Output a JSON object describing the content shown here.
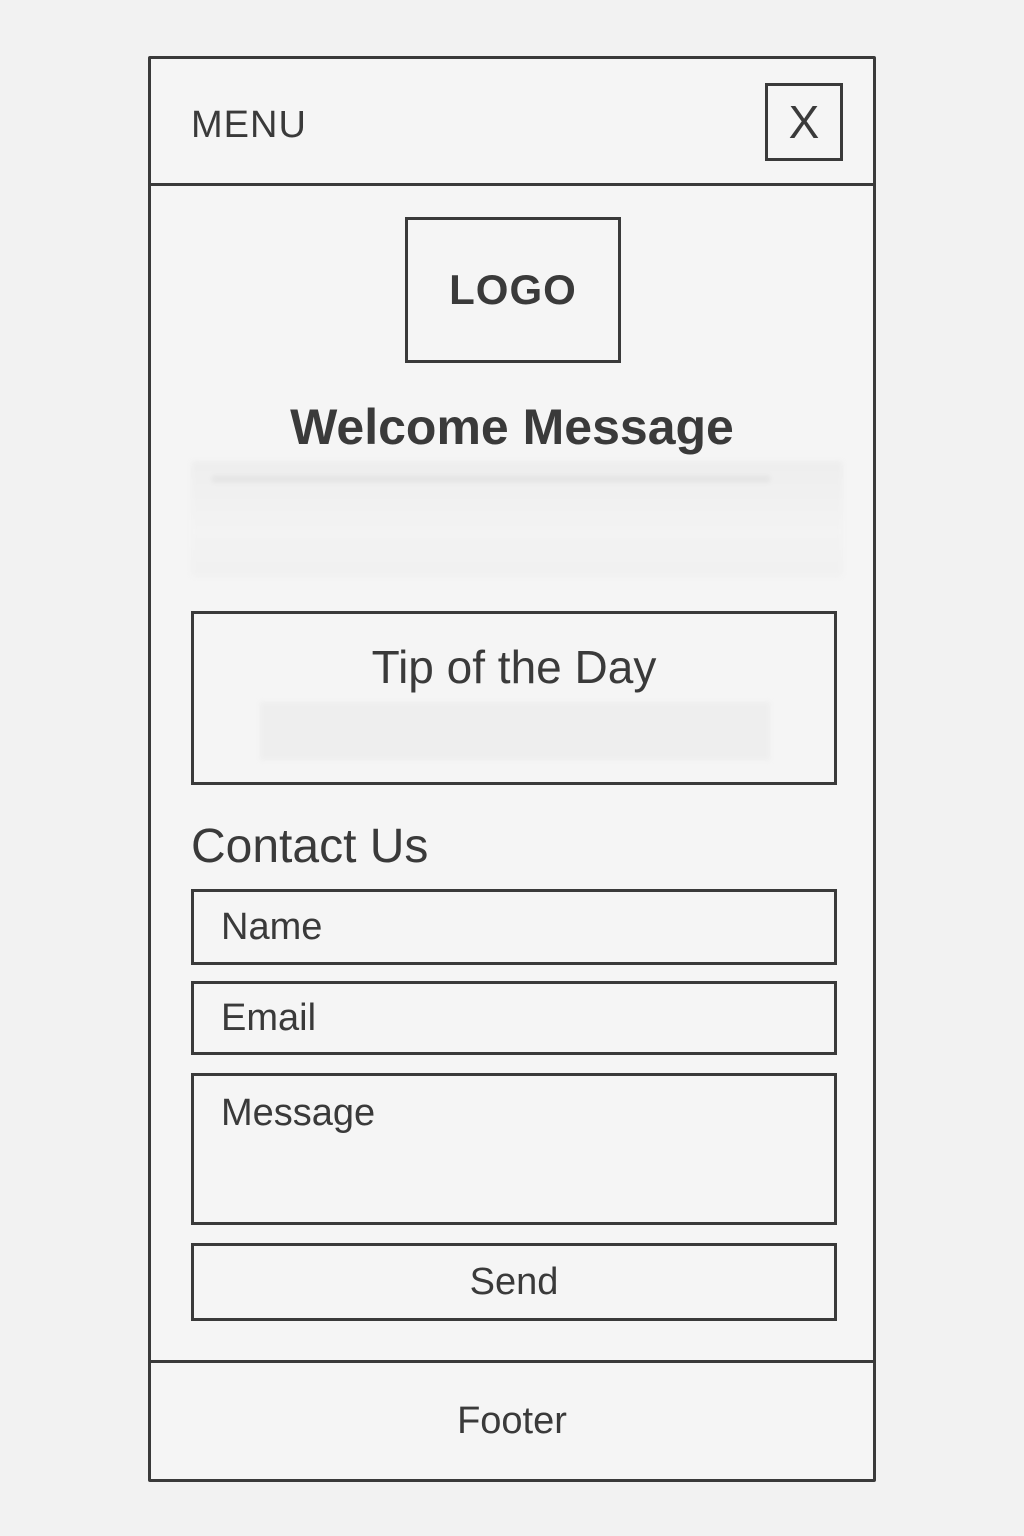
{
  "header": {
    "menu_label": "MENU",
    "close_label": "X"
  },
  "logo": {
    "label": "LOGO"
  },
  "welcome": {
    "title": "Welcome Message"
  },
  "tip": {
    "title": "Tip of the Day"
  },
  "contact": {
    "title": "Contact Us",
    "name_placeholder": "Name",
    "email_placeholder": "Email",
    "message_placeholder": "Message",
    "send_label": "Send"
  },
  "footer": {
    "label": "Footer"
  },
  "colors": {
    "stroke": "#3a3a3a",
    "background": "#f2f2f2"
  }
}
